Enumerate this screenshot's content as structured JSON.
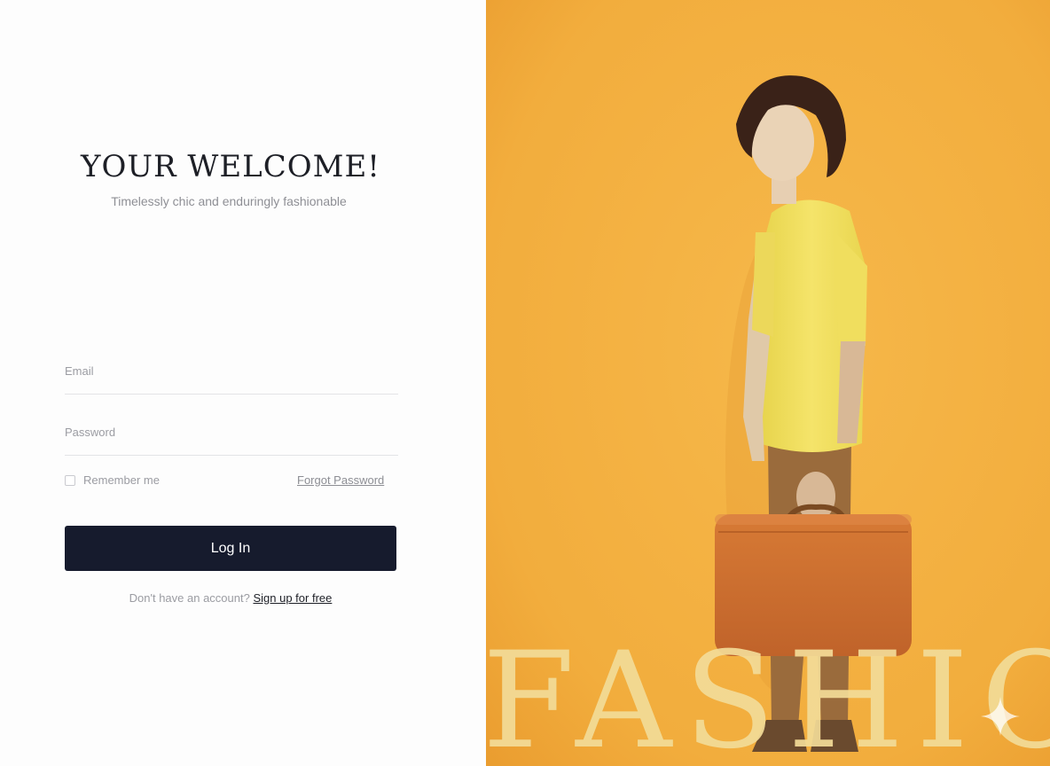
{
  "login": {
    "title": "YOUR WELCOME!",
    "subtitle": "Timelessly chic and enduringly fashionable",
    "email_label": "Email",
    "email_value": "",
    "password_label": "Password",
    "password_value": "",
    "remember_label": "Remember me",
    "remember_checked": false,
    "forgot_label": "Forgot Password",
    "login_button": "Log In",
    "no_account_text": "Don't have an account?",
    "signup_link": "Sign up for free"
  },
  "hero": {
    "overlay_text": "FASHION",
    "image_icon": "fashion-model-photo",
    "watermark_icon": "sparkle-icon"
  },
  "colors": {
    "button": "#161b2d",
    "hero_background": "#f2ad3d",
    "overlay_text": "#f3dc98"
  }
}
